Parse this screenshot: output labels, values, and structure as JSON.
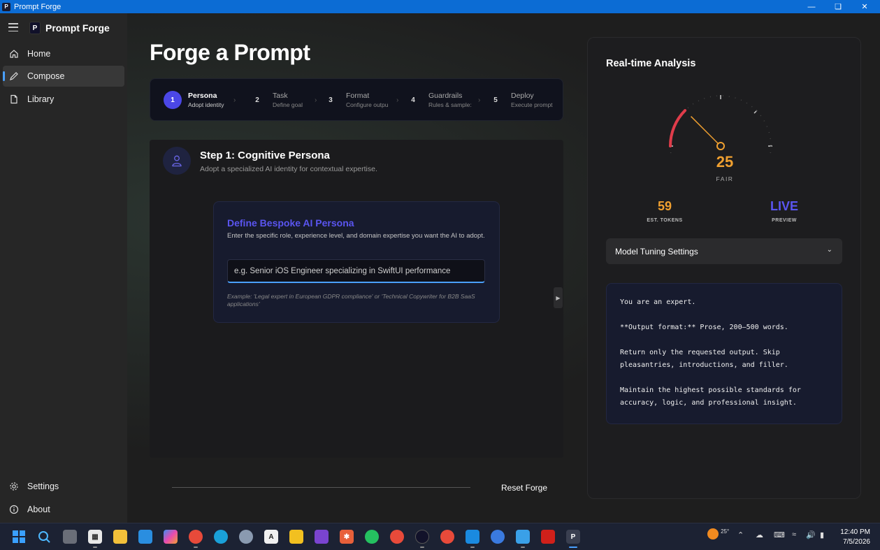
{
  "window": {
    "title": "Prompt Forge"
  },
  "sidebar": {
    "brand": "Prompt Forge",
    "items": [
      {
        "label": "Home",
        "icon": "home-icon"
      },
      {
        "label": "Compose",
        "icon": "pencil-icon",
        "active": true
      },
      {
        "label": "Library",
        "icon": "document-icon"
      }
    ],
    "footer": [
      {
        "label": "Settings",
        "icon": "gear-icon"
      },
      {
        "label": "About",
        "icon": "info-icon"
      }
    ]
  },
  "main": {
    "title": "Forge a Prompt",
    "steps": [
      {
        "num": "1",
        "title": "Persona",
        "sub": "Adopt identity",
        "active": true
      },
      {
        "num": "2",
        "title": "Task",
        "sub": "Define goal"
      },
      {
        "num": "3",
        "title": "Format",
        "sub": "Configure outpu"
      },
      {
        "num": "4",
        "title": "Guardrails",
        "sub": "Rules & sample:"
      },
      {
        "num": "5",
        "title": "Deploy",
        "sub": "Execute prompt"
      }
    ],
    "step_card": {
      "title": "Step 1: Cognitive Persona",
      "subtitle": "Adopt a specialized AI identity for contextual expertise."
    },
    "persona": {
      "title": "Define Bespoke AI Persona",
      "description": "Enter the specific role, experience level, and domain expertise you want the AI to adopt.",
      "placeholder": "e.g. Senior iOS Engineer specializing in SwiftUI performance",
      "value": "",
      "example": "Example: 'Legal expert in European GDPR compliance' or 'Technical Copywriter for B2B SaaS applications'"
    },
    "reset_label": "Reset Forge"
  },
  "analysis": {
    "title": "Real-time Analysis",
    "score": "25",
    "score_label": "FAIR",
    "score_fraction": 0.25,
    "tokens": {
      "value": "59",
      "label": "EST. TOKENS"
    },
    "preview_status": {
      "value": "LIVE",
      "label": "PREVIEW"
    },
    "tuning_label": "Model Tuning Settings",
    "preview_lines": [
      "You are an expert.",
      "**Output format:** Prose, 200–500 words.",
      "Return only the requested output. Skip pleasantries, introductions, and filler.",
      "Maintain the highest possible standards for accuracy, logic, and professional insight."
    ],
    "colors": {
      "score": "#f0a030",
      "tokens": "#f0a030",
      "live": "#5a55f0",
      "gauge_arc": "#e03c4a"
    }
  },
  "taskbar": {
    "weather": "25°",
    "time": "12:40 PM",
    "date": "7/5/2026"
  }
}
